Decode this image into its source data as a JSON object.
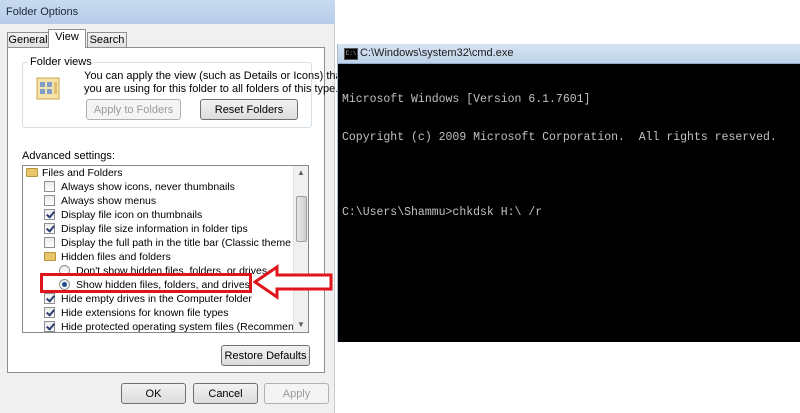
{
  "dialog": {
    "title": "Folder Options",
    "tabs": [
      "General",
      "View",
      "Search"
    ],
    "active_tab": "View",
    "folder_views": {
      "label": "Folder views",
      "description_line1": "You can apply the view (such as Details or Icons) that",
      "description_line2": "you are using for this folder to all folders of this type.",
      "apply_button": "Apply to Folders",
      "reset_button": "Reset Folders"
    },
    "advanced_settings_label": "Advanced settings:",
    "advanced_items": [
      {
        "label": "Files and Folders",
        "kind": "folder",
        "checked": false
      },
      {
        "label": "Always show icons, never thumbnails",
        "kind": "checkbox",
        "checked": false
      },
      {
        "label": "Always show menus",
        "kind": "checkbox",
        "checked": false
      },
      {
        "label": "Display file icon on thumbnails",
        "kind": "checkbox",
        "checked": true
      },
      {
        "label": "Display file size information in folder tips",
        "kind": "checkbox",
        "checked": true
      },
      {
        "label": "Display the full path in the title bar (Classic theme only)",
        "kind": "checkbox",
        "checked": false
      },
      {
        "label": "Hidden files and folders",
        "kind": "folder",
        "checked": false
      },
      {
        "label": "Don't show hidden files, folders, or drives",
        "kind": "radio",
        "checked": false
      },
      {
        "label": "Show hidden files, folders, and drives",
        "kind": "radio",
        "checked": true
      },
      {
        "label": "Hide empty drives in the Computer folder",
        "kind": "checkbox",
        "checked": true
      },
      {
        "label": "Hide extensions for known file types",
        "kind": "checkbox",
        "checked": true
      },
      {
        "label": "Hide protected operating system files (Recommended)",
        "kind": "checkbox",
        "checked": true
      }
    ],
    "restore_defaults_button": "Restore Defaults",
    "ok_button": "OK",
    "cancel_button": "Cancel",
    "apply_button": "Apply"
  },
  "cmd": {
    "title": "C:\\Windows\\system32\\cmd.exe",
    "icon_text": "C:\\",
    "lines": [
      "Microsoft Windows [Version 6.1.7601]",
      "Copyright (c) 2009 Microsoft Corporation.  All rights reserved.",
      "",
      "C:\\Users\\Shammu>chkdsk H:\\ /r"
    ]
  },
  "annotation": {
    "color": "#e0141b"
  }
}
